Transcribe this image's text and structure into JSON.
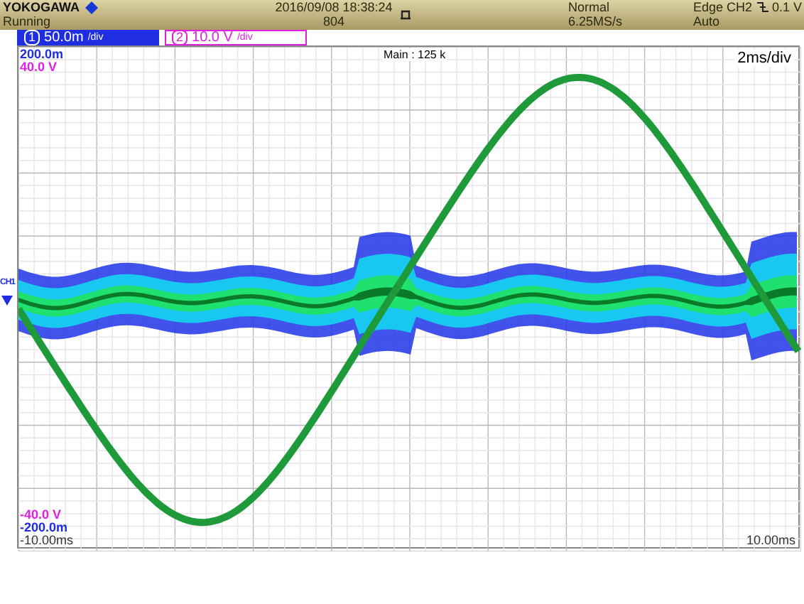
{
  "header": {
    "brand": "YOKOGAWA",
    "datetime": "2016/09/08 18:38:24",
    "status": "Running",
    "count": "804",
    "mode": "Normal",
    "sample_rate": "6.25MS/s",
    "trigger_source": "Edge CH2",
    "trigger_level": "0.1 V",
    "trigger_mode": "Auto"
  },
  "channels": [
    {
      "number": "1",
      "scale": "50.0m",
      "unit": "/div",
      "color": "#1f2ee0",
      "selected": true
    },
    {
      "number": "2",
      "scale": "10.0 V",
      "unit": "/div",
      "color": "#e020e0",
      "selected": false
    }
  ],
  "screen": {
    "zoom": "Main : 125 k",
    "timebase": "2ms/div",
    "ch1_top": "200.0m",
    "ch2_top": "40.0 V",
    "ch2_bottom": "-40.0 V",
    "ch1_bottom": "-200.0m",
    "time_left": "-10.00ms",
    "time_right": "10.00ms",
    "ground_marker": "CH1"
  }
}
